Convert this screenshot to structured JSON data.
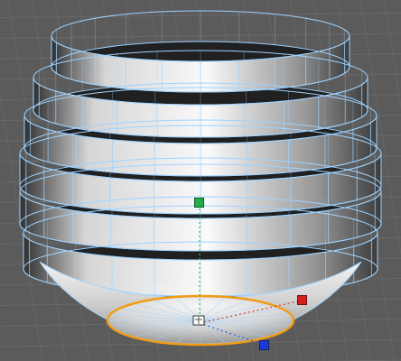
{
  "app": {
    "viewport_kind": "3D perspective viewport"
  },
  "scene": {
    "object_name": "",
    "selection_type": "edge loop",
    "theme": {
      "background": "#5b5b5b",
      "grid_line": "#6d6d6d",
      "mesh_wire": "#9fd3ff",
      "mesh_dark": "#1e1e1e",
      "mesh_light": "#f1f1f1",
      "selection": "#f39c12",
      "gizmo_x": "#d61f1f",
      "gizmo_y": "#1fb04a",
      "gizmo_z": "#1f3bd6"
    },
    "icons": {
      "pivot_icon": "object-pivot-icon",
      "x_handle": "gizmo-x-handle-icon",
      "y_handle": "gizmo-y-handle-icon",
      "z_handle": "gizmo-z-handle-icon"
    },
    "mesh": {
      "ribs": 6,
      "segments": 24
    }
  }
}
